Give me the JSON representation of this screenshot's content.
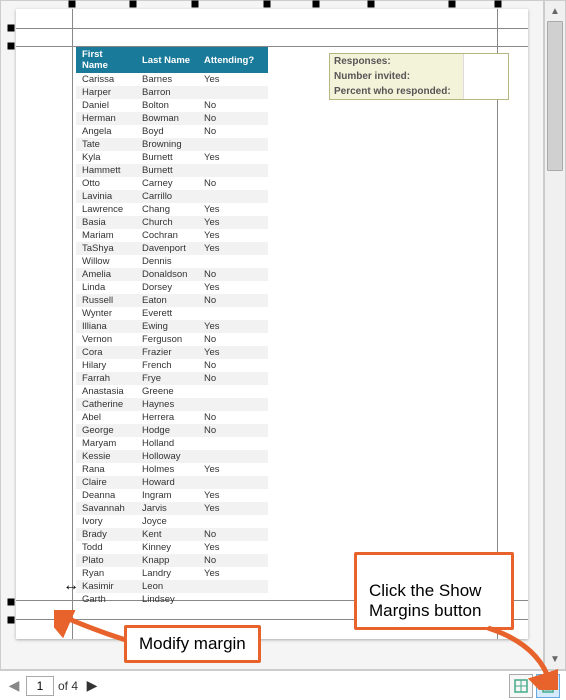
{
  "table": {
    "headers": {
      "first": "First Name",
      "last": "Last Name",
      "attending": "Attending?"
    },
    "rows": [
      {
        "first": "Carissa",
        "last": "Barnes",
        "attending": "Yes"
      },
      {
        "first": "Harper",
        "last": "Barron",
        "attending": ""
      },
      {
        "first": "Daniel",
        "last": "Bolton",
        "attending": "No"
      },
      {
        "first": "Herman",
        "last": "Bowman",
        "attending": "No"
      },
      {
        "first": "Angela",
        "last": "Boyd",
        "attending": "No"
      },
      {
        "first": "Tate",
        "last": "Browning",
        "attending": ""
      },
      {
        "first": "Kyla",
        "last": "Burnett",
        "attending": "Yes"
      },
      {
        "first": "Hammett",
        "last": "Burnett",
        "attending": ""
      },
      {
        "first": "Otto",
        "last": "Carney",
        "attending": "No"
      },
      {
        "first": "Lavinia",
        "last": "Carrillo",
        "attending": ""
      },
      {
        "first": "Lawrence",
        "last": "Chang",
        "attending": "Yes"
      },
      {
        "first": "Basia",
        "last": "Church",
        "attending": "Yes"
      },
      {
        "first": "Mariam",
        "last": "Cochran",
        "attending": "Yes"
      },
      {
        "first": "TaShya",
        "last": "Davenport",
        "attending": "Yes"
      },
      {
        "first": "Willow",
        "last": "Dennis",
        "attending": ""
      },
      {
        "first": "Amelia",
        "last": "Donaldson",
        "attending": "No"
      },
      {
        "first": "Linda",
        "last": "Dorsey",
        "attending": "Yes"
      },
      {
        "first": "Russell",
        "last": "Eaton",
        "attending": "No"
      },
      {
        "first": "Wynter",
        "last": "Everett",
        "attending": ""
      },
      {
        "first": "Illiana",
        "last": "Ewing",
        "attending": "Yes"
      },
      {
        "first": "Vernon",
        "last": "Ferguson",
        "attending": "No"
      },
      {
        "first": "Cora",
        "last": "Frazier",
        "attending": "Yes"
      },
      {
        "first": "Hilary",
        "last": "French",
        "attending": "No"
      },
      {
        "first": "Farrah",
        "last": "Frye",
        "attending": "No"
      },
      {
        "first": "Anastasia",
        "last": "Greene",
        "attending": ""
      },
      {
        "first": "Catherine",
        "last": "Haynes",
        "attending": ""
      },
      {
        "first": "Abel",
        "last": "Herrera",
        "attending": "No"
      },
      {
        "first": "George",
        "last": "Hodge",
        "attending": "No"
      },
      {
        "first": "Maryam",
        "last": "Holland",
        "attending": ""
      },
      {
        "first": "Kessie",
        "last": "Holloway",
        "attending": ""
      },
      {
        "first": "Rana",
        "last": "Holmes",
        "attending": "Yes"
      },
      {
        "first": "Claire",
        "last": "Howard",
        "attending": ""
      },
      {
        "first": "Deanna",
        "last": "Ingram",
        "attending": "Yes"
      },
      {
        "first": "Savannah",
        "last": "Jarvis",
        "attending": "Yes"
      },
      {
        "first": "Ivory",
        "last": "Joyce",
        "attending": ""
      },
      {
        "first": "Brady",
        "last": "Kent",
        "attending": "No"
      },
      {
        "first": "Todd",
        "last": "Kinney",
        "attending": "Yes"
      },
      {
        "first": "Plato",
        "last": "Knapp",
        "attending": "No"
      },
      {
        "first": "Ryan",
        "last": "Landry",
        "attending": "Yes"
      },
      {
        "first": "Kasimir",
        "last": "Leon",
        "attending": ""
      },
      {
        "first": "Garth",
        "last": "Lindsey",
        "attending": ""
      }
    ]
  },
  "sidebox": {
    "responses": "Responses:",
    "invited": "Number invited:",
    "percent": "Percent who responded:"
  },
  "nav": {
    "current_page": "1",
    "of_label": "of 4"
  },
  "callouts": {
    "modify_margin": "Modify margin",
    "show_margins": "Click the Show\nMargins button"
  }
}
